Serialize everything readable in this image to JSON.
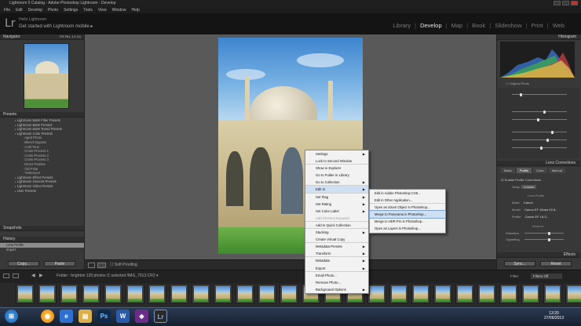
{
  "window": {
    "title": "Lightroom 5 Catalog - Adobe Photoshop Lightroom - Develop"
  },
  "menubar": [
    "File",
    "Edit",
    "Develop",
    "Photo",
    "Settings",
    "Tools",
    "View",
    "Window",
    "Help"
  ],
  "identity": {
    "logo": "Lr",
    "user": "Hello Lightroom",
    "subtitle": "Get started with Lightroom mobile"
  },
  "modules": {
    "items": [
      "Library",
      "Develop",
      "Map",
      "Book",
      "Slideshow",
      "Print",
      "Web"
    ],
    "active": "Develop"
  },
  "left_panel": {
    "navigator": {
      "title": "Navigator",
      "zoom": "FIT  FILL  1:1  3:1"
    },
    "presets": {
      "title": "Presets",
      "items": [
        {
          "label": "Lightroom B&W Filter Presets",
          "level": 0
        },
        {
          "label": "Lightroom B&W Presets",
          "level": 0
        },
        {
          "label": "Lightroom B&W Toned Presets",
          "level": 0
        },
        {
          "label": "Lightroom Color Presets",
          "level": 0,
          "open": true
        },
        {
          "label": "Aged Photo",
          "level": 1
        },
        {
          "label": "Bleach Bypass",
          "level": 1
        },
        {
          "label": "Cold Tone",
          "level": 1
        },
        {
          "label": "Cross Process 1",
          "level": 1
        },
        {
          "label": "Cross Process 2",
          "level": 1
        },
        {
          "label": "Cross Process 3",
          "level": 1
        },
        {
          "label": "Direct Positive",
          "level": 1
        },
        {
          "label": "Old Polar",
          "level": 1
        },
        {
          "label": "Yesteryear",
          "level": 1
        },
        {
          "label": "Lightroom Effect Presets",
          "level": 0
        },
        {
          "label": "Lightroom General Presets",
          "level": 0
        },
        {
          "label": "Lightroom Video Presets",
          "level": 0
        },
        {
          "label": "User Presets",
          "level": 0
        }
      ]
    },
    "snapshots": {
      "title": "Snapshots"
    },
    "history": {
      "title": "History",
      "items": [
        "Lens Profile",
        "Import"
      ]
    },
    "copy_label": "Copy...",
    "paste_label": "Paste"
  },
  "toolbar": {
    "soft_proofing": "Soft Proofing"
  },
  "right_panel": {
    "histogram_title": "Histogram",
    "original_photo": "Original Photo",
    "lens_title": "Lens Corrections",
    "lens_tabs": [
      "Basic",
      "Profile",
      "Color",
      "Manual"
    ],
    "enable_profile": "Enable Profile Corrections",
    "setup_label": "Setup",
    "setup_value": "Custom",
    "lens_profile_heading": "Lens Profile",
    "make_label": "Make",
    "make_value": "Canon",
    "model_label": "Model",
    "model_value": "Canon EF 16mm f/2.8...",
    "profile_label": "Profile",
    "profile_value": "Canon EF 16-3...",
    "amount_heading": "Amount",
    "distortion_label": "Distortion",
    "vignetting_label": "Vignetting",
    "effects_title": "Effects",
    "prev_label": "Sync...",
    "reset_label": "Reset",
    "filter_label": "Filter:",
    "filter_value": "Filters Off"
  },
  "filmstrip": {
    "info": "Folder : brighton    133 photos /1 selected /IMG_7913.CR2 ▾"
  },
  "context_menu": {
    "items": [
      {
        "label": "Settings",
        "submenu": true
      },
      {
        "label": "Lock to Second Window"
      },
      {
        "label": "Show in Explorer"
      },
      {
        "label": "Go to Folder in Library"
      },
      {
        "label": "Go to Collection",
        "submenu": true
      },
      {
        "label": "Edit In",
        "submenu": true,
        "highlighted": true
      },
      {
        "label": "Set Flag",
        "submenu": true
      },
      {
        "label": "Set Rating",
        "submenu": true
      },
      {
        "label": "Set Color Label",
        "submenu": true
      },
      {
        "label": "Add Shortcut Keyword",
        "disabled": true
      },
      {
        "label": "Add to Quick Collection"
      },
      {
        "label": "Stacking",
        "submenu": true
      },
      {
        "label": "Create Virtual Copy"
      },
      {
        "label": "Metadata Presets",
        "submenu": true
      },
      {
        "label": "Transform",
        "submenu": true
      },
      {
        "label": "Metadata",
        "submenu": true
      },
      {
        "label": "Export",
        "submenu": true
      },
      {
        "label": "Email Photo..."
      },
      {
        "label": "Remove Photo..."
      },
      {
        "label": "Background Options",
        "submenu": true
      }
    ],
    "edit_in_submenu": [
      "Edit in Adobe Photoshop CS6...",
      "Edit in Other Application...",
      "Open as Smart Object in Photoshop...",
      "Merge to Panorama in Photoshop...",
      "Merge to HDR Pro in Photoshop...",
      "Open as Layers in Photoshop..."
    ],
    "submenu_highlighted": "Merge to Panorama in Photoshop..."
  },
  "taskbar": {
    "time": "13:20",
    "date": "27/06/2013"
  },
  "colors": {
    "menu_highlight": "#cfe0f5",
    "panel": "#383838",
    "center_bg": "#595959"
  }
}
